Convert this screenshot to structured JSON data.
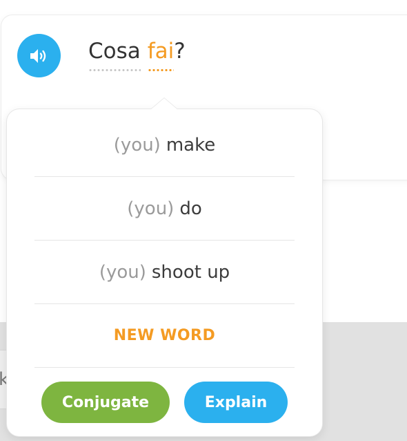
{
  "colors": {
    "accent_orange": "#f49b23",
    "blue": "#2bb0ee",
    "green": "#7eb540",
    "grey_text": "#9a9a9a"
  },
  "speaker": {
    "icon": "speaker-icon"
  },
  "sentence": {
    "word1": "Cosa",
    "word2": "fai",
    "punctuation": "?"
  },
  "popover": {
    "translations": [
      {
        "pronoun": "(you)",
        "word": "make"
      },
      {
        "pronoun": "(you)",
        "word": "do"
      },
      {
        "pronoun": "(you)",
        "word": "shoot up"
      }
    ],
    "new_word_label": "NEW WORD",
    "conjugate_label": "Conjugate",
    "explain_label": "Explain"
  },
  "background_input": {
    "partial_text": "k"
  }
}
